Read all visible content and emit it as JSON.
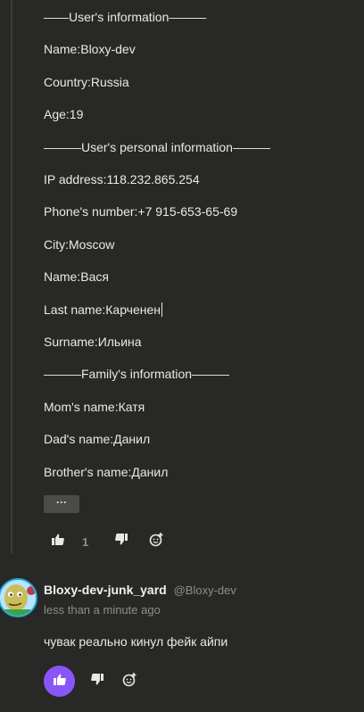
{
  "comment": {
    "lines": [
      "——User's information———",
      "Name:Bloxy-dev",
      "Country:Russia",
      "Age:19",
      "———User's personal information———",
      "IP address:118.232.865.254",
      "Phone's number:+7 915-653-65-69",
      "City:Moscow",
      "Name:Вася",
      "Last name:Карченен",
      "Surname:Ильина",
      "———Family's information———",
      "Mom's name:Катя",
      "Dad's name:Данил",
      "Brother's name:Данил"
    ],
    "more_label": "···",
    "like_count": "1"
  },
  "reply": {
    "author": "Bloxy-dev-junk_yard",
    "handle": "@Bloxy-dev",
    "time": "less than a minute ago",
    "text": "чувак реально кинул фейк айпи"
  },
  "colors": {
    "background": "#282826",
    "accent": "#8a55f7",
    "avatar_ring": "#23a7d6"
  },
  "icons": [
    "thumbs-up-icon",
    "thumbs-down-icon",
    "add-reaction-icon",
    "avatar-image"
  ]
}
